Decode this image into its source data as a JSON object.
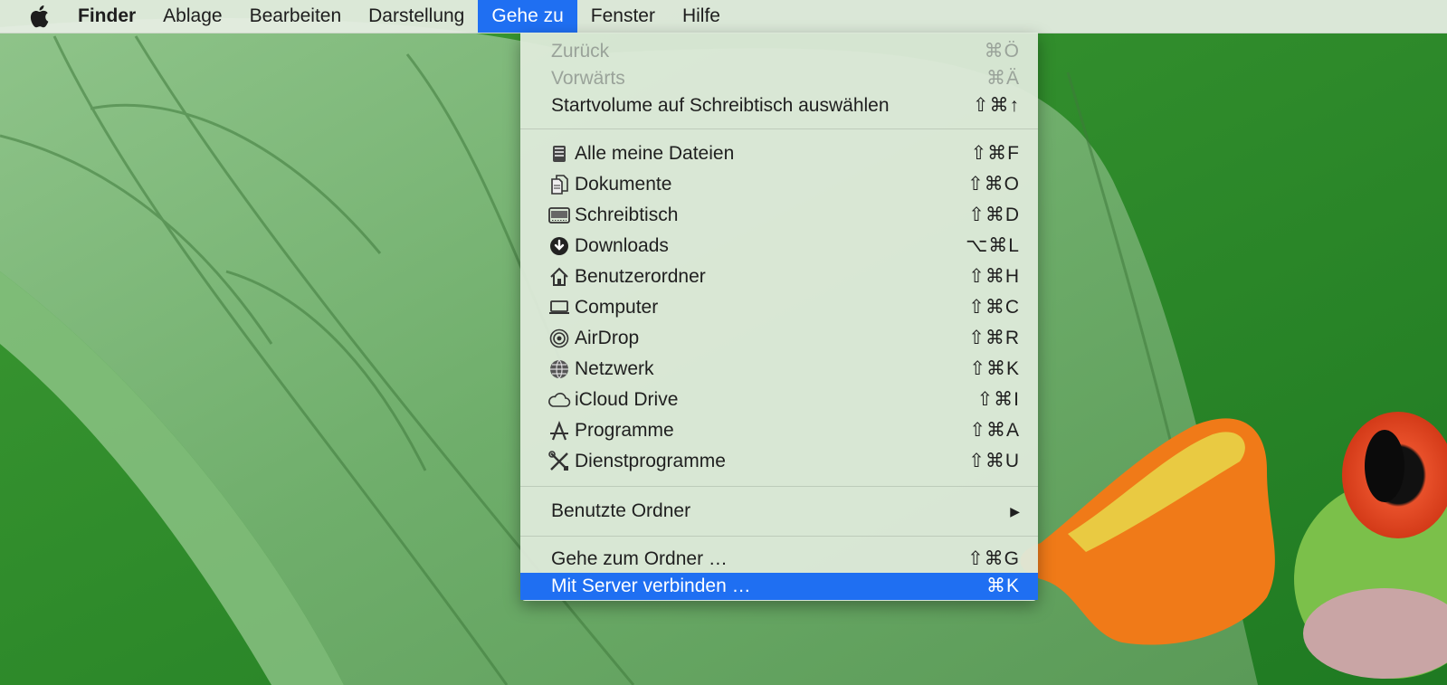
{
  "menubar": {
    "app_name": "Finder",
    "items": [
      "Ablage",
      "Bearbeiten",
      "Darstellung",
      "Gehe zu",
      "Fenster",
      "Hilfe"
    ]
  },
  "menu": {
    "group1": [
      {
        "label": "Zurück",
        "shortcut": "⌘Ö",
        "disabled": true
      },
      {
        "label": "Vorwärts",
        "shortcut": "⌘Ä",
        "disabled": true
      },
      {
        "label": "Startvolume auf Schreibtisch auswählen",
        "shortcut": "⇧⌘↑",
        "disabled": false
      }
    ],
    "places": [
      {
        "label": "Alle meine Dateien",
        "shortcut": "⇧⌘F",
        "icon": "all-files-icon"
      },
      {
        "label": "Dokumente",
        "shortcut": "⇧⌘O",
        "icon": "documents-icon"
      },
      {
        "label": "Schreibtisch",
        "shortcut": "⇧⌘D",
        "icon": "desktop-icon"
      },
      {
        "label": "Downloads",
        "shortcut": "⌥⌘L",
        "icon": "downloads-icon"
      },
      {
        "label": "Benutzerordner",
        "shortcut": "⇧⌘H",
        "icon": "home-icon"
      },
      {
        "label": "Computer",
        "shortcut": "⇧⌘C",
        "icon": "computer-icon"
      },
      {
        "label": "AirDrop",
        "shortcut": "⇧⌘R",
        "icon": "airdrop-icon"
      },
      {
        "label": "Netzwerk",
        "shortcut": "⇧⌘K",
        "icon": "network-icon"
      },
      {
        "label": "iCloud Drive",
        "shortcut": "⇧⌘I",
        "icon": "icloud-icon"
      },
      {
        "label": "Programme",
        "shortcut": "⇧⌘A",
        "icon": "applications-icon"
      },
      {
        "label": "Dienstprogramme",
        "shortcut": "⇧⌘U",
        "icon": "utilities-icon"
      }
    ],
    "recent": {
      "label": "Benutzte Ordner",
      "submenu_arrow": "▶"
    },
    "group4": [
      {
        "label": "Gehe zum Ordner …",
        "shortcut": "⇧⌘G",
        "selected": false
      },
      {
        "label": "Mit Server verbinden …",
        "shortcut": "⌘K",
        "selected": true
      }
    ]
  },
  "colors": {
    "accent": "#1f6ff2",
    "menu_bg": "#deeada",
    "disabled_text": "#9aa39a"
  }
}
